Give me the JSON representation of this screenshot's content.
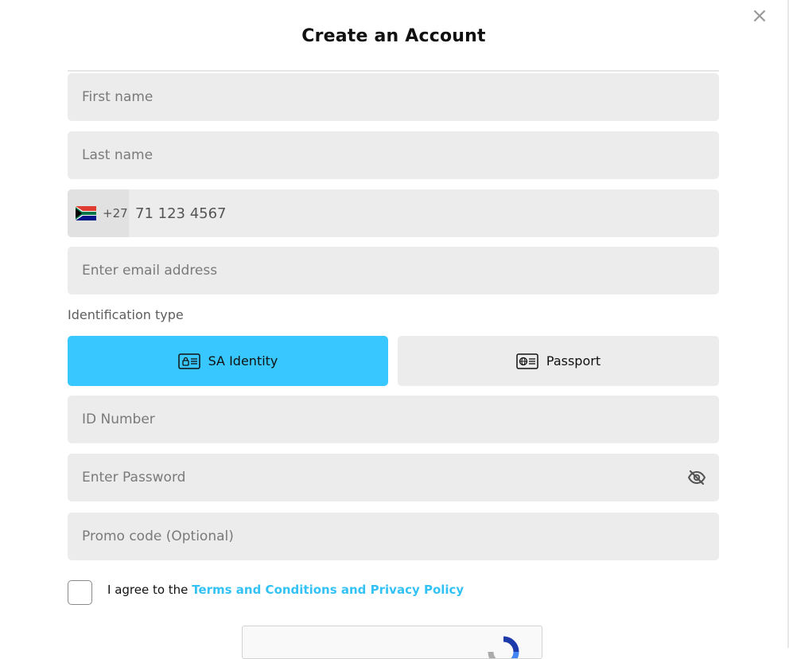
{
  "modal": {
    "title": "Create an Account",
    "close_glyph": "×"
  },
  "form": {
    "first_name_placeholder": "First name",
    "last_name_placeholder": "Last name",
    "phone": {
      "country_flag_icon": "south-africa-flag-icon",
      "country_code": "+27",
      "placeholder": "71 123 4567"
    },
    "email_placeholder": "Enter email address",
    "id_type": {
      "label": "Identification type",
      "options": [
        {
          "label": "SA Identity",
          "icon": "id-card-icon",
          "selected": true
        },
        {
          "label": "Passport",
          "icon": "passport-icon",
          "selected": false
        }
      ]
    },
    "id_number_placeholder": "ID Number",
    "password_placeholder": "Enter Password",
    "password_toggle_icon": "eye-off-icon",
    "promo_placeholder": "Promo code (Optional)",
    "agree_prefix": "I agree to the",
    "agree_link": "Terms and Conditions and Privacy Policy",
    "captcha_icon": "recaptcha-icon"
  },
  "colors": {
    "accent": "#38c8ff",
    "link": "#33c2f5",
    "field_bg": "#ececec"
  }
}
